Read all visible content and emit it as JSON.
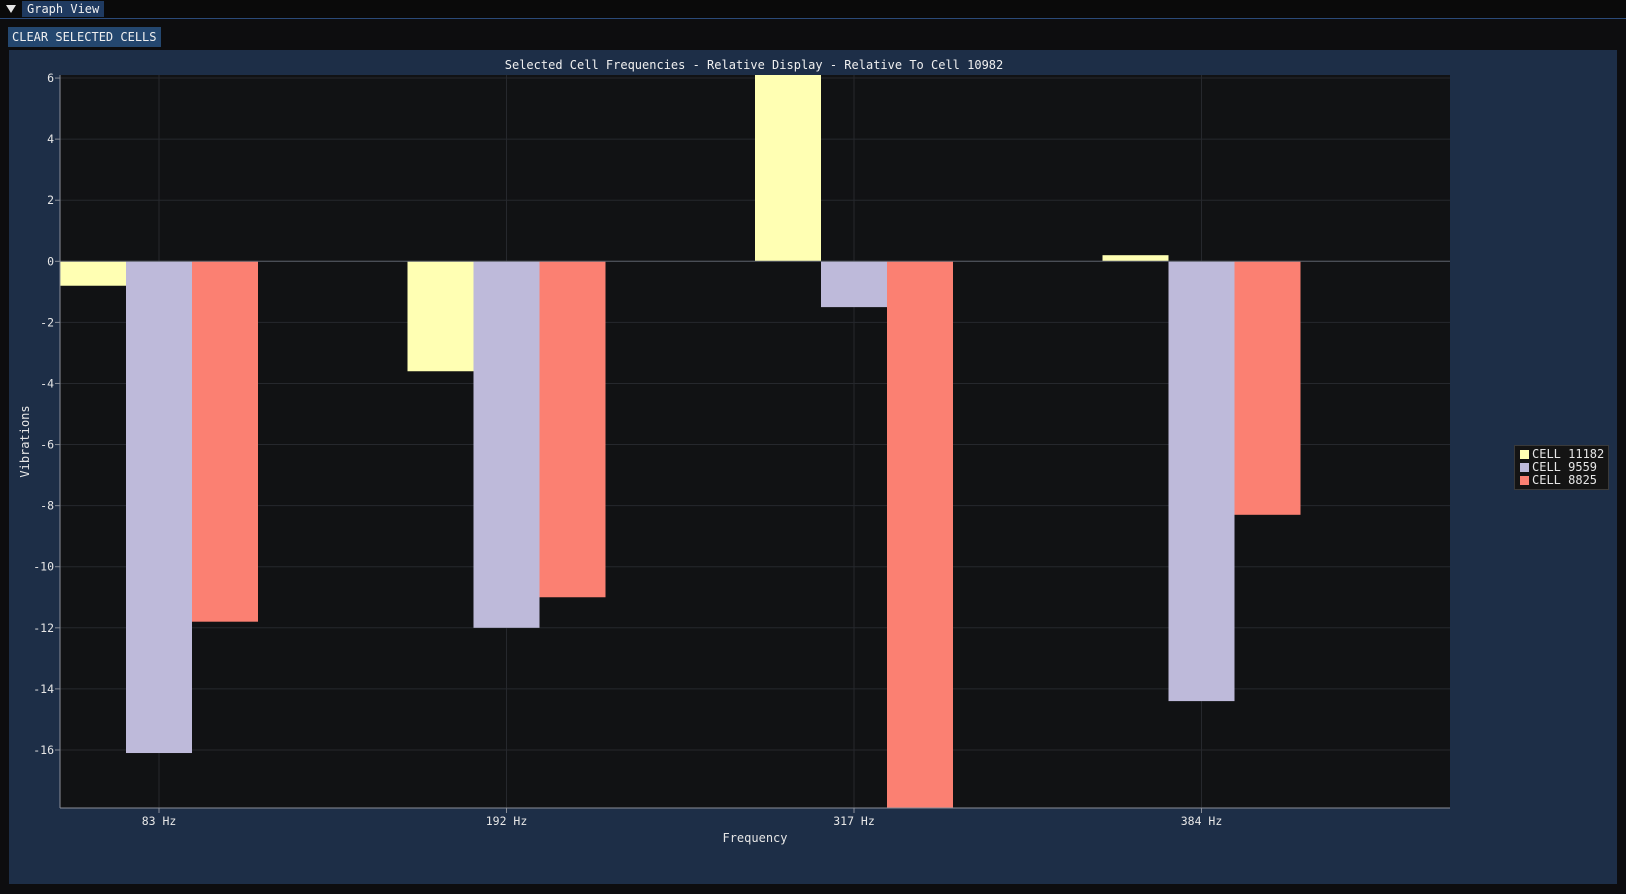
{
  "window": {
    "tab_label": "Graph View"
  },
  "toolbar": {
    "clear_label": "CLEAR SELECTED CELLS"
  },
  "chart_data": {
    "type": "bar",
    "title": "Selected Cell Frequencies - Relative Display - Relative To Cell 10982",
    "xlabel": "Frequency",
    "ylabel": "Vibrations",
    "categories": [
      "83 Hz",
      "192 Hz",
      "317 Hz",
      "384 Hz"
    ],
    "ylim": [
      -17.9,
      6.1
    ],
    "yticks": [
      6,
      4,
      2,
      0,
      -2,
      -4,
      -6,
      -8,
      -10,
      -12,
      -14,
      -16
    ],
    "grid": true,
    "legend_position": "right",
    "series": [
      {
        "name": "CELL 11182",
        "color": "#ffffb3",
        "values": [
          -0.8,
          -3.6,
          6.1,
          0.2
        ]
      },
      {
        "name": "CELL 9559",
        "color": "#bebada",
        "values": [
          -16.1,
          -12.0,
          -1.5,
          -14.4
        ]
      },
      {
        "name": "CELL 8825",
        "color": "#fb8072",
        "values": [
          -11.8,
          -11.0,
          -17.9,
          -8.3
        ]
      }
    ]
  }
}
